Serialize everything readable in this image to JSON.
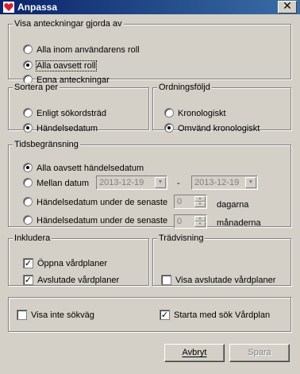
{
  "window": {
    "title": "Anpassa",
    "close_symbol": "✕"
  },
  "group_visa": {
    "legend": "Visa anteckningar gjorda av",
    "options": [
      "Alla inom användarens roll",
      "Alla oavsett roll",
      "Egna anteckningar"
    ],
    "selected": 1
  },
  "group_sortera": {
    "legend": "Sortera per",
    "options": [
      "Enligt sökordsträd",
      "Händelsedatum"
    ],
    "selected": 1
  },
  "group_ordning": {
    "legend": "Ordningsföljd",
    "options": [
      "Kronologiskt",
      "Omvänd kronologiskt"
    ],
    "selected": 1
  },
  "group_tid": {
    "legend": "Tidsbegränsning",
    "option_all": "Alla oavsett händelsedatum",
    "option_between": "Mellan datum",
    "date_from": "2013-12-19",
    "date_separator": "-",
    "date_to": "2013-12-19",
    "option_days": "Händelsedatum under de senaste",
    "days_value": "0",
    "days_unit": "dagarna",
    "option_months": "Händelsedatum under de senaste",
    "months_value": "0",
    "months_unit": "månaderna",
    "selected": 0
  },
  "group_inkludera": {
    "legend": "Inkludera",
    "items": [
      {
        "label": "Öppna vårdplaner",
        "checked": true
      },
      {
        "label": "Avslutade vårdplaner",
        "checked": true
      }
    ]
  },
  "group_trad": {
    "legend": "Trädvisning",
    "item": {
      "label": "Visa avslutade vårdplaner",
      "checked": false
    }
  },
  "bottom": {
    "hide_path": {
      "label": "Visa inte sökväg",
      "checked": false
    },
    "start_search": {
      "label": "Starta med sök Vårdplan",
      "checked": true
    }
  },
  "buttons": {
    "cancel": "Avbryt",
    "save": "Spara"
  },
  "colors": {
    "window_bg": "#d4d0c8",
    "title_start": "#0a246a",
    "title_end": "#3a6ea5"
  },
  "icons": {
    "app": "heart-icon"
  }
}
